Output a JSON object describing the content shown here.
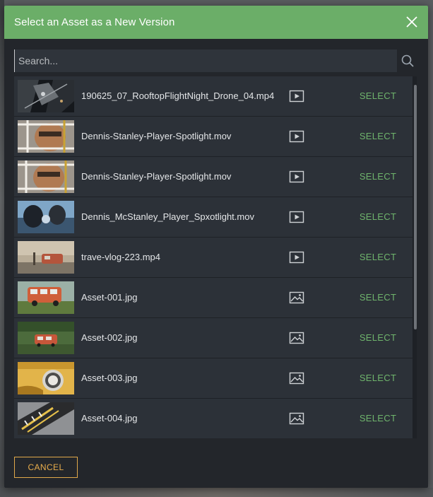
{
  "dialog": {
    "title": "Select an Asset as a New Version",
    "close_icon": "close-icon"
  },
  "search": {
    "placeholder": "Search...",
    "value": "",
    "icon": "search-icon"
  },
  "assets": [
    {
      "name": "190625_07_RooftopFlightNight_Drone_04.mp4",
      "type": "video",
      "select_label": "SELECT"
    },
    {
      "name": "Dennis-Stanley-Player-Spotlight.mov",
      "type": "video",
      "select_label": "SELECT"
    },
    {
      "name": "Dennis-Stanley-Player-Spotlight.mov",
      "type": "video",
      "select_label": "SELECT"
    },
    {
      "name": "Dennis_McStanley_Player_Spxotlight.mov",
      "type": "video",
      "select_label": "SELECT"
    },
    {
      "name": "trave-vlog-223.mp4",
      "type": "video",
      "select_label": "SELECT"
    },
    {
      "name": "Asset-001.jpg",
      "type": "image",
      "select_label": "SELECT"
    },
    {
      "name": "Asset-002.jpg",
      "type": "image",
      "select_label": "SELECT"
    },
    {
      "name": "Asset-003.jpg",
      "type": "image",
      "select_label": "SELECT"
    },
    {
      "name": "Asset-004.jpg",
      "type": "image",
      "select_label": "SELECT"
    }
  ],
  "footer": {
    "cancel_label": "CANCEL"
  },
  "colors": {
    "header_bg": "#6bae68",
    "select_text": "#6fb46c",
    "cancel_accent": "#e8ad4c",
    "row_bg": "#2c3138"
  }
}
